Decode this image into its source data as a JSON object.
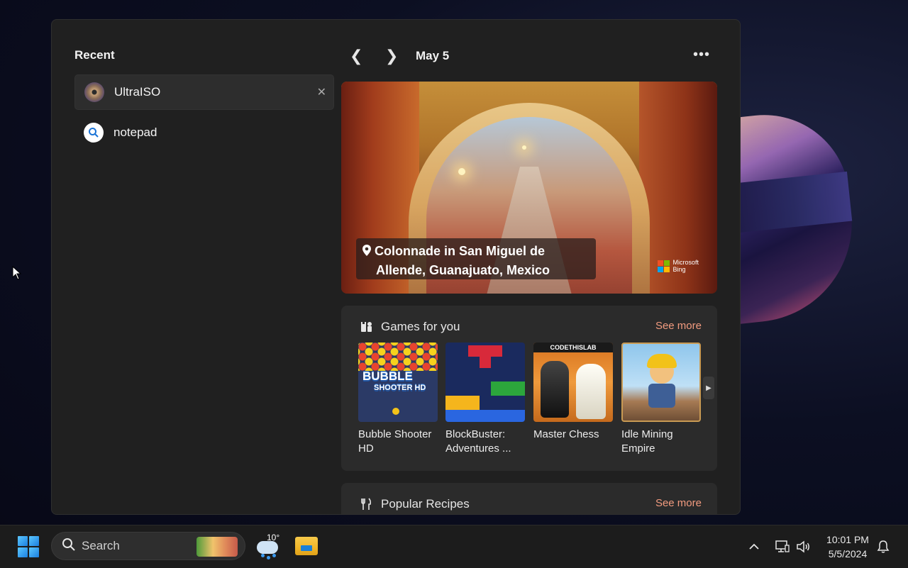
{
  "search_panel": {
    "recent": {
      "title": "Recent",
      "items": [
        {
          "label": "UltraISO",
          "icon": "ultraiso-app-icon",
          "close_glyph": "✕"
        },
        {
          "label": "notepad",
          "icon": "search-icon"
        }
      ]
    },
    "nav": {
      "prev_glyph": "❮",
      "next_glyph": "❯",
      "date": "May 5",
      "more_glyph": "•••"
    },
    "hero": {
      "caption_line1": "Colonnade in San Miguel de",
      "caption_line2": "Allende, Guanajuato, Mexico",
      "attribution_line1": "Microsoft",
      "attribution_line2": "Bing"
    },
    "games": {
      "title": "Games for you",
      "see_more": "See more",
      "items": [
        {
          "name": "Bubble Shooter HD",
          "thumb_text": "BUBBLE",
          "thumb_text2": "SHOOTER HD"
        },
        {
          "name": "BlockBuster: Adventures ..."
        },
        {
          "name": "Master Chess",
          "thumb_brand": "CODETHISLAB"
        },
        {
          "name": "Idle Mining Empire"
        }
      ]
    },
    "recipes": {
      "title": "Popular Recipes",
      "see_more": "See more"
    }
  },
  "taskbar": {
    "search_placeholder": "Search",
    "weather_temp": "10°",
    "clock_time": "10:01 PM",
    "clock_date": "5/5/2024"
  },
  "colors": {
    "accent_link": "#f29b7f",
    "panel_bg": "#202020",
    "card_bg": "#2b2b2b",
    "taskbar_bg": "#1c1c1c"
  }
}
